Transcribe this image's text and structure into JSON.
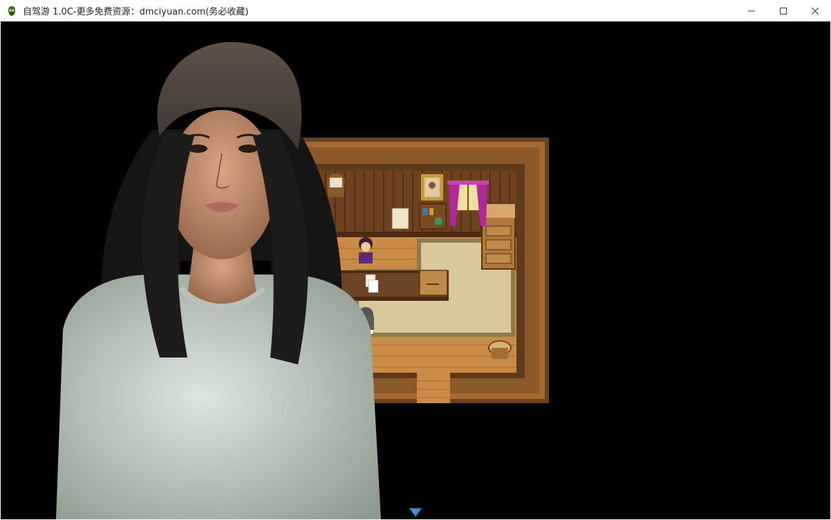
{
  "window": {
    "title": "自驾游 1.0C-更多免费资源：dmciyuan.com(务必收藏)",
    "icon": "app-icon",
    "controls": [
      "minimize-icon",
      "maximize-icon",
      "close-icon"
    ]
  },
  "game": {
    "background_color": "#000000",
    "scene": "top-down room map with character portrait",
    "indicator": "message-advance-arrow-icon"
  },
  "colors": {
    "wood_frame": "#7a4c22",
    "wood_floor": "#c98b45",
    "carpet": "#d8c99a",
    "curtain": "#b0289a",
    "arrow": "#4a8fd8"
  }
}
